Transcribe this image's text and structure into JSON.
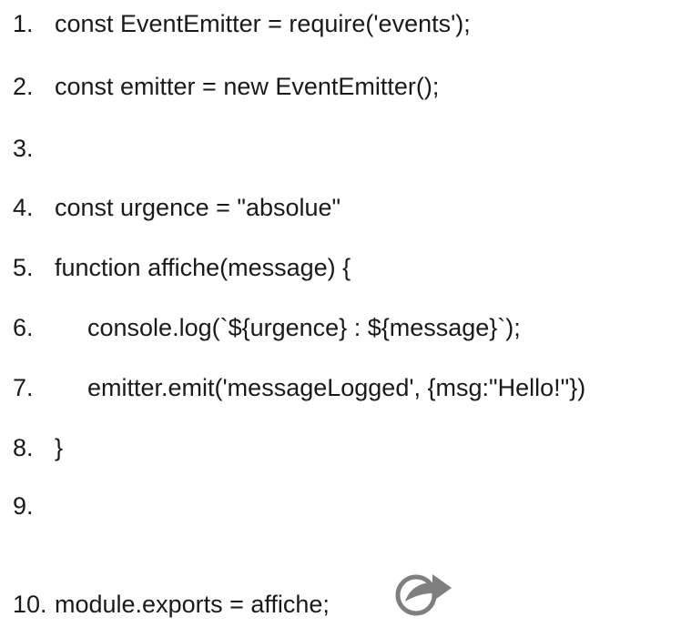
{
  "code": {
    "lines": [
      {
        "number": "1.",
        "text": "const EventEmitter = require('events');"
      },
      {
        "number": "2.",
        "text": "const emitter = new EventEmitter();"
      },
      {
        "number": "3.",
        "text": ""
      },
      {
        "number": "4.",
        "text": "const urgence = \"absolue\""
      },
      {
        "number": "5.",
        "text": "function affiche(message) {"
      },
      {
        "number": "6.",
        "text": "console.log(`${urgence} : ${message}`);"
      },
      {
        "number": "7.",
        "text": "emitter.emit('messageLogged', {msg:\"Hello!\"})"
      },
      {
        "number": "8.",
        "text": "}"
      },
      {
        "number": "9.",
        "text": ""
      },
      {
        "number": "10.",
        "text": "module.exports = affiche;"
      }
    ]
  },
  "icons": {
    "share": "share-icon"
  },
  "colors": {
    "text": "#1a1a1a",
    "icon": "#7f7f7f",
    "background": "#ffffff"
  }
}
